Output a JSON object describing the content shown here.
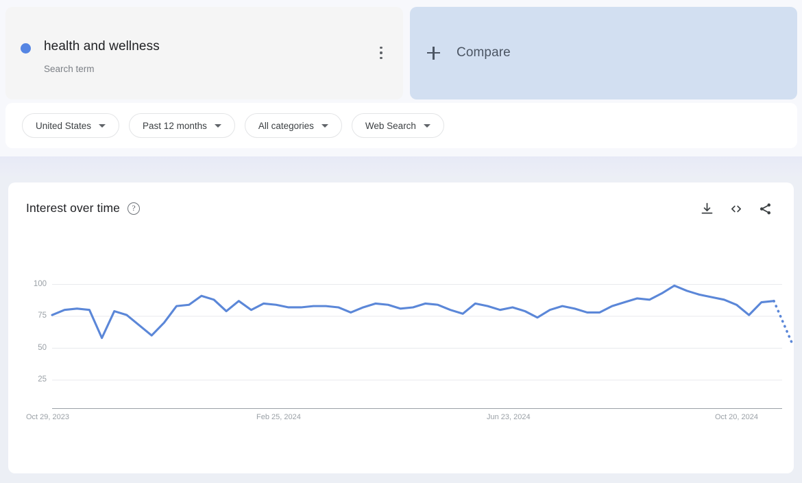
{
  "term": {
    "name": "health and wellness",
    "type_label": "Search term",
    "dot_color": "#5585e3",
    "menu_icon": "kebab-menu-icon"
  },
  "compare": {
    "label": "Compare",
    "icon": "plus-icon"
  },
  "filters": [
    {
      "label": "United States",
      "name": "region"
    },
    {
      "label": "Past 12 months",
      "name": "time-range"
    },
    {
      "label": "All categories",
      "name": "category"
    },
    {
      "label": "Web Search",
      "name": "search-type"
    }
  ],
  "chart_panel": {
    "title": "Interest over time",
    "help_icon": "question-mark-icon",
    "actions": [
      {
        "name": "download-csv-icon",
        "label": "Download"
      },
      {
        "name": "embed-code-icon",
        "label": "Embed"
      },
      {
        "name": "share-icon",
        "label": "Share"
      }
    ]
  },
  "chart_data": {
    "type": "line",
    "title": "Interest over time",
    "xlabel": "",
    "ylabel": "",
    "ylim": [
      0,
      100
    ],
    "yticks": [
      100,
      75,
      50,
      25
    ],
    "grid": true,
    "legend": false,
    "line_color": "#5b87d8",
    "xtick_labels": [
      "Oct 29, 2023",
      "Feb 25, 2024",
      "Jun 23, 2024",
      "Oct 20, 2024"
    ],
    "series": [
      {
        "name": "health and wellness",
        "values": [
          76,
          80,
          81,
          80,
          58,
          79,
          76,
          68,
          60,
          70,
          83,
          84,
          91,
          88,
          79,
          87,
          80,
          85,
          84,
          82,
          82,
          83,
          83,
          82,
          78,
          82,
          85,
          84,
          81,
          82,
          85,
          84,
          80,
          77,
          85,
          83,
          80,
          82,
          79,
          74,
          80,
          83,
          81,
          78,
          78,
          83,
          86,
          89,
          88,
          93,
          99,
          95,
          92,
          90,
          88,
          84,
          76,
          86,
          87
        ],
        "partial_tail": [
          87,
          52
        ]
      }
    ]
  }
}
